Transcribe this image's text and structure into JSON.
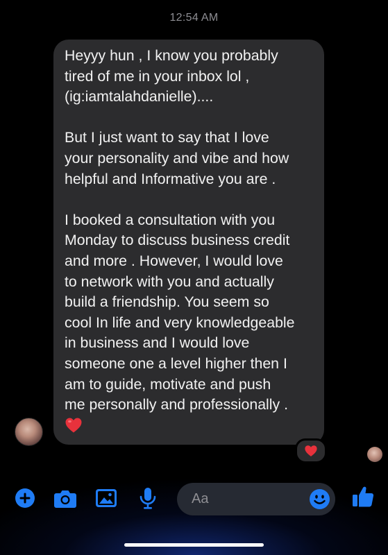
{
  "header": {
    "timestamp": "12:54 AM"
  },
  "message": {
    "paragraphs": [
      "Heyyy hun , I know you probably\ntired of me in your inbox lol ,\n(ig:iamtalahdanielle)....",
      "But I just want to say that I love\nyour personality and vibe and how\nhelpful and Informative you are .",
      "I booked a consultation with you\nMonday to discuss business credit\nand more . However, I would love\nto network with you and actually\nbuild a friendship. You seem so\ncool In life and very knowledgeable\nin business and I would love\nsomeone one a level higher then I\nam to guide, motivate and push\nme personally and professionally ."
    ],
    "trailing_emoji": "heart-emoji",
    "reaction": "heart-emoji"
  },
  "composer": {
    "placeholder": "Aa",
    "icons": [
      "plus-icon",
      "camera-icon",
      "image-icon",
      "microphone-icon",
      "emoji-icon",
      "thumbs-up-icon"
    ]
  },
  "colors": {
    "accent": "#1f7cf5",
    "bubble": "#2c2c2e",
    "heart": "#e8323c"
  }
}
